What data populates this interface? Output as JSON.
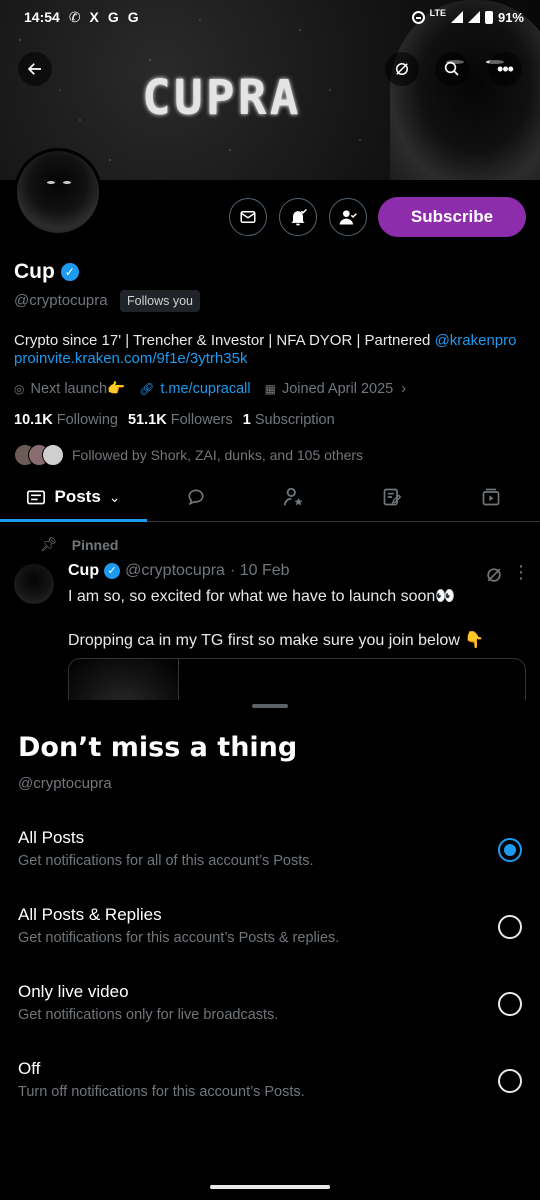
{
  "status_bar": {
    "time": "14:54",
    "app_glyphs": [
      "X",
      "G",
      "G"
    ],
    "network": "LTE",
    "battery": "91%"
  },
  "banner": {
    "logo_text": "CUPRA"
  },
  "profile": {
    "name": "Cup",
    "handle": "@cryptocupra",
    "follows_you": "Follows you",
    "subscribe_label": "Subscribe",
    "bio": {
      "text": "Crypto since 17' | Trencher & Investor | NFA DYOR | Partnered ",
      "mention": "@krakenpro",
      "link": "proinvite.kraken.com/9f1e/3ytrh35k"
    },
    "meta": {
      "location": "Next launch👉",
      "website": "t.me/cupracall",
      "joined": "Joined April 2025"
    },
    "stats": {
      "following_count": "10.1K",
      "following_label": "Following",
      "followers_count": "51.1K",
      "followers_label": "Followers",
      "subscription_count": "1",
      "subscription_label": "Subscription"
    },
    "followed_by": "Followed by Shork, ZAI, dunks, and 105 others"
  },
  "tabs": {
    "posts_label": "Posts"
  },
  "pinned_post": {
    "pinned_label": "Pinned",
    "author": "Cup",
    "handle": "@cryptocupra",
    "date": "· 10 Feb",
    "line1": "I am so, so excited for what we have to launch soon👀",
    "line2": "Dropping ca in my TG first so make sure you join below 👇"
  },
  "sheet": {
    "title": "Don’t miss a thing",
    "handle": "@cryptocupra",
    "options": [
      {
        "title": "All Posts",
        "desc": "Get notifications for all of this account’s Posts.",
        "selected": true
      },
      {
        "title": "All Posts & Replies",
        "desc": "Get notifications for this account’s Posts & replies.",
        "selected": false
      },
      {
        "title": "Only live video",
        "desc": "Get notifications only for live broadcasts.",
        "selected": false
      },
      {
        "title": "Off",
        "desc": "Turn off notifications for this account’s Posts.",
        "selected": false
      }
    ]
  },
  "colors": {
    "accent": "#1d9bf0",
    "subscribe": "#8e2dac",
    "muted": "#71767b",
    "background": "#000000"
  }
}
